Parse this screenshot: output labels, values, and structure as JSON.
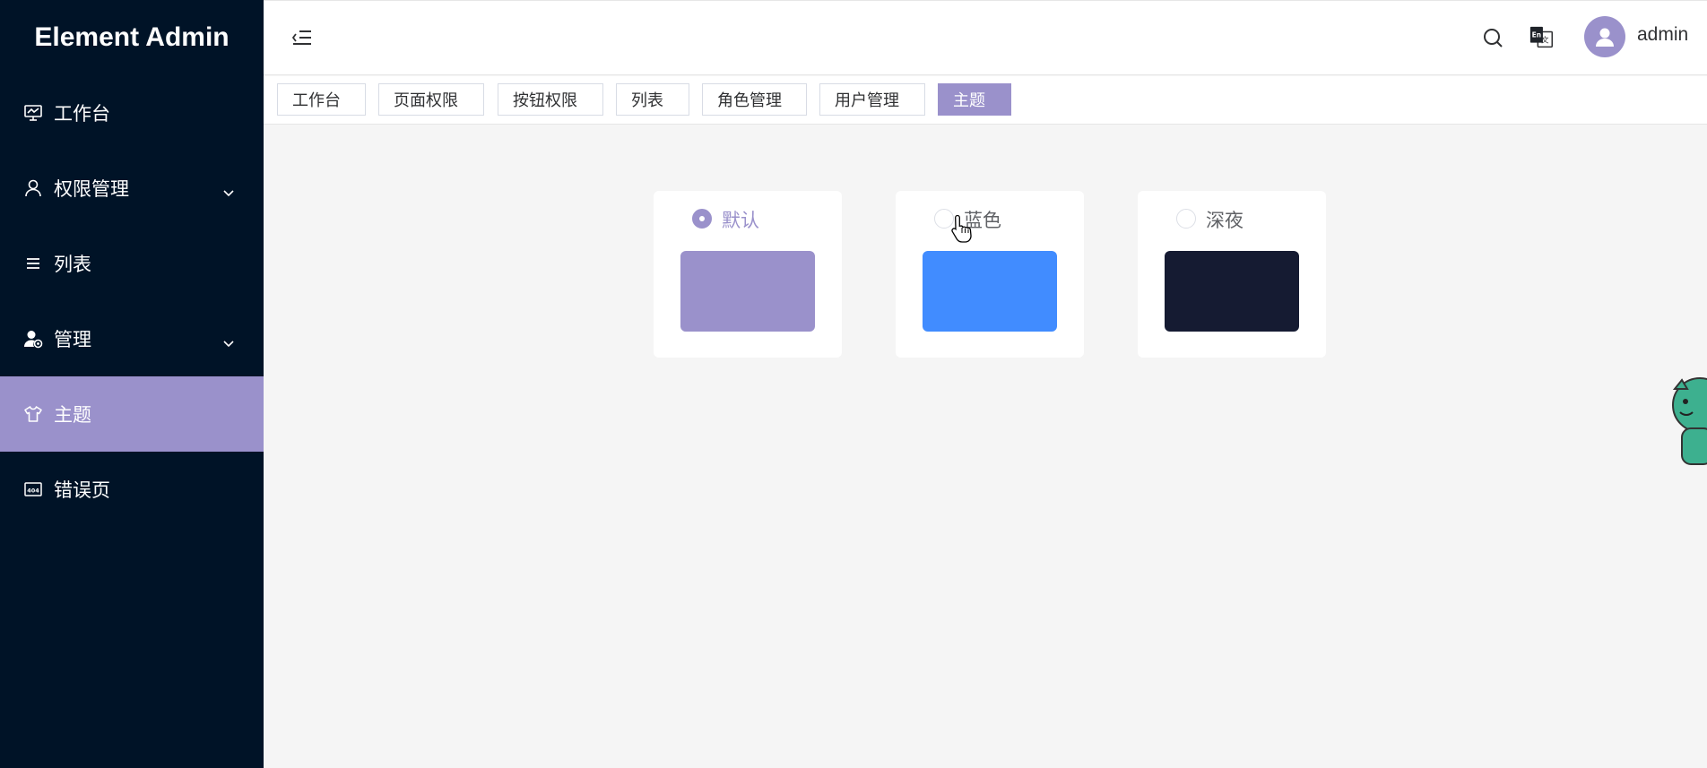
{
  "app": {
    "title": "Element Admin"
  },
  "sidebar": {
    "items": [
      {
        "label": "工作台",
        "icon": "dashboard-icon",
        "active": false,
        "expandable": false
      },
      {
        "label": "权限管理",
        "icon": "user-icon",
        "active": false,
        "expandable": true
      },
      {
        "label": "列表",
        "icon": "list-icon",
        "active": false,
        "expandable": false
      },
      {
        "label": "管理",
        "icon": "user-settings-icon",
        "active": false,
        "expandable": true
      },
      {
        "label": "主题",
        "icon": "tshirt-icon",
        "active": true,
        "expandable": false
      },
      {
        "label": "错误页",
        "icon": "error-404-icon",
        "active": false,
        "expandable": false
      }
    ]
  },
  "header": {
    "icons": [
      "menu-fold-icon",
      "search-icon",
      "translate-icon"
    ],
    "username": "admin"
  },
  "tags": [
    {
      "label": "工作台",
      "active": false
    },
    {
      "label": "页面权限",
      "active": false
    },
    {
      "label": "按钮权限",
      "active": false
    },
    {
      "label": "列表",
      "active": false
    },
    {
      "label": "角色管理",
      "active": false
    },
    {
      "label": "用户管理",
      "active": false
    },
    {
      "label": "主题",
      "active": true
    }
  ],
  "themes": [
    {
      "label": "默认",
      "color": "#9a91cb",
      "checked": true
    },
    {
      "label": "蓝色",
      "color": "#418cff",
      "checked": false
    },
    {
      "label": "深夜",
      "color": "#151b32",
      "checked": false
    }
  ],
  "colors": {
    "sidebar_bg": "#001327",
    "accent": "#9a91cb",
    "page_bg": "#f5f5f5"
  }
}
